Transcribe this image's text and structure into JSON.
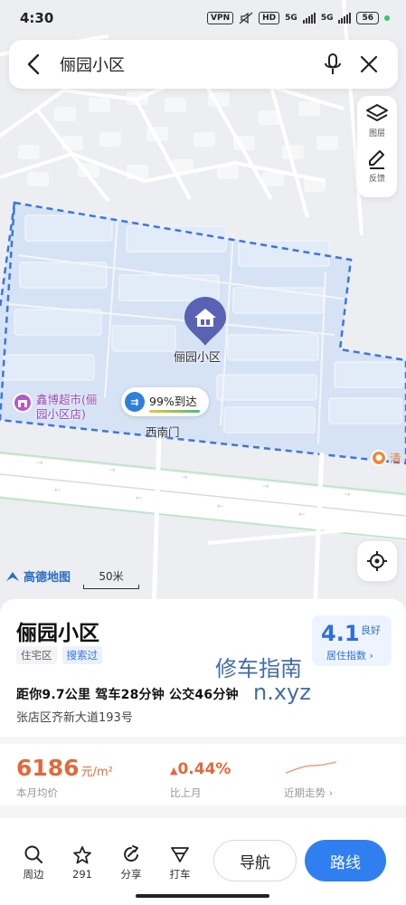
{
  "status_bar": {
    "time": "4:30",
    "vpn": "VPN",
    "hd": "HD",
    "sig1": "5G",
    "sig2": "5G",
    "battery": "56"
  },
  "search": {
    "query": "俪园小区"
  },
  "map_controls": {
    "layers_label": "图层",
    "feedback_label": "反馈"
  },
  "map": {
    "main_poi_label": "俪园小区",
    "shop_label_line1": "鑫博超市(俪",
    "shop_label_line2": "园小区店)",
    "gate_percent": "99%到达",
    "gate_label": "西南门",
    "clipped_poi": "清",
    "brand": "高德地图",
    "scale": "50米",
    "area_color": "#d6e3f5",
    "boundary_color": "#3a78d8"
  },
  "place": {
    "name": "俪园小区",
    "tags": [
      "住宅区",
      "搜索过"
    ],
    "score": "4.1",
    "score_level": "良好",
    "score_link": "居住指数 ›",
    "distance": "距你9.7公里   驾车28分钟   公交46分钟",
    "address": "张店区齐新大道193号",
    "watermark_line1": "修车指南",
    "watermark_line2": "n.xyz"
  },
  "price": {
    "value": "6186",
    "unit": "元/m²",
    "caption": "本月均价",
    "change": "0.44%",
    "change_caption": "比上月",
    "trend_caption": "近期走势 ›"
  },
  "actions": {
    "nearby": "周边",
    "favorites": "291",
    "share": "分享",
    "taxi": "打车",
    "navigate": "导航",
    "route": "路线"
  },
  "colors": {
    "accent": "#2f7ff0",
    "price": "#e2693a",
    "score": "#2f6fd6"
  }
}
